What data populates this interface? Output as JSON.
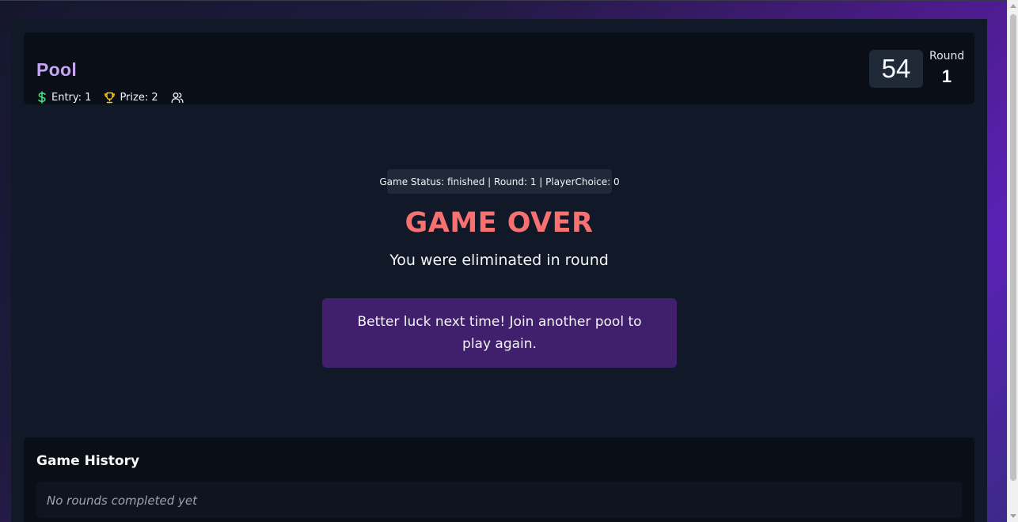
{
  "header": {
    "title": "Pool",
    "entry_label": "Entry: 1",
    "prize_label": "Prize: 2",
    "timer": "54",
    "round_label": "Round",
    "round_value": "1"
  },
  "icons": {
    "entry": "dollar-icon",
    "prize": "trophy-icon",
    "players": "users-icon"
  },
  "colors": {
    "title": "#c8a4f5",
    "entry_icon": "#4ade80",
    "prize_icon": "#facc15",
    "game_over": "#f87171",
    "message_box": "#401f6c"
  },
  "main": {
    "status_text": "Game Status: finished | Round: 1 | PlayerChoice: 0",
    "game_over": "GAME OVER",
    "eliminated_text": "You were eliminated in round",
    "message": "Better luck next time! Join another pool to play again."
  },
  "history": {
    "title": "Game History",
    "empty_text": "No rounds completed yet"
  }
}
